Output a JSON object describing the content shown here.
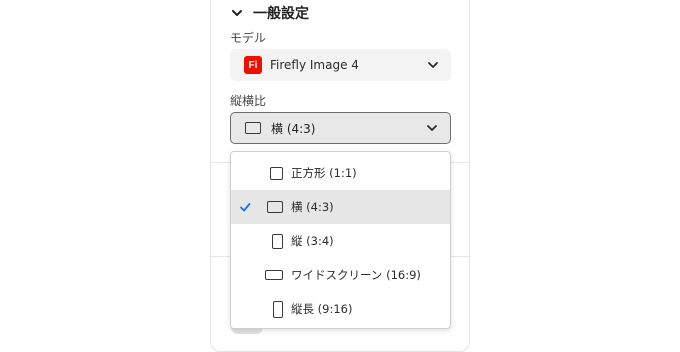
{
  "section": {
    "title": "一般設定"
  },
  "model": {
    "label": "モデル",
    "logo_text": "Fi",
    "value": "Firefly Image 4",
    "logo_color": "#eb1000"
  },
  "aspect_ratio": {
    "label": "縦横比",
    "value": "横 (4:3)",
    "options": [
      {
        "label": "正方形 (1:1)",
        "icon": "square-shape-icon",
        "selected": false
      },
      {
        "label": "横 (4:3)",
        "icon": "landscape-shape-icon",
        "selected": true
      },
      {
        "label": "縦 (3:4)",
        "icon": "portrait-shape-icon",
        "selected": false
      },
      {
        "label": "ワイドスクリーン (16:9)",
        "icon": "widescreen-shape-icon",
        "selected": false
      },
      {
        "label": "縦長 (9:16)",
        "icon": "tall-portrait-shape-icon",
        "selected": false
      }
    ]
  },
  "colors": {
    "accent": "#1473e6",
    "selected_bg": "#e6e6e6"
  }
}
